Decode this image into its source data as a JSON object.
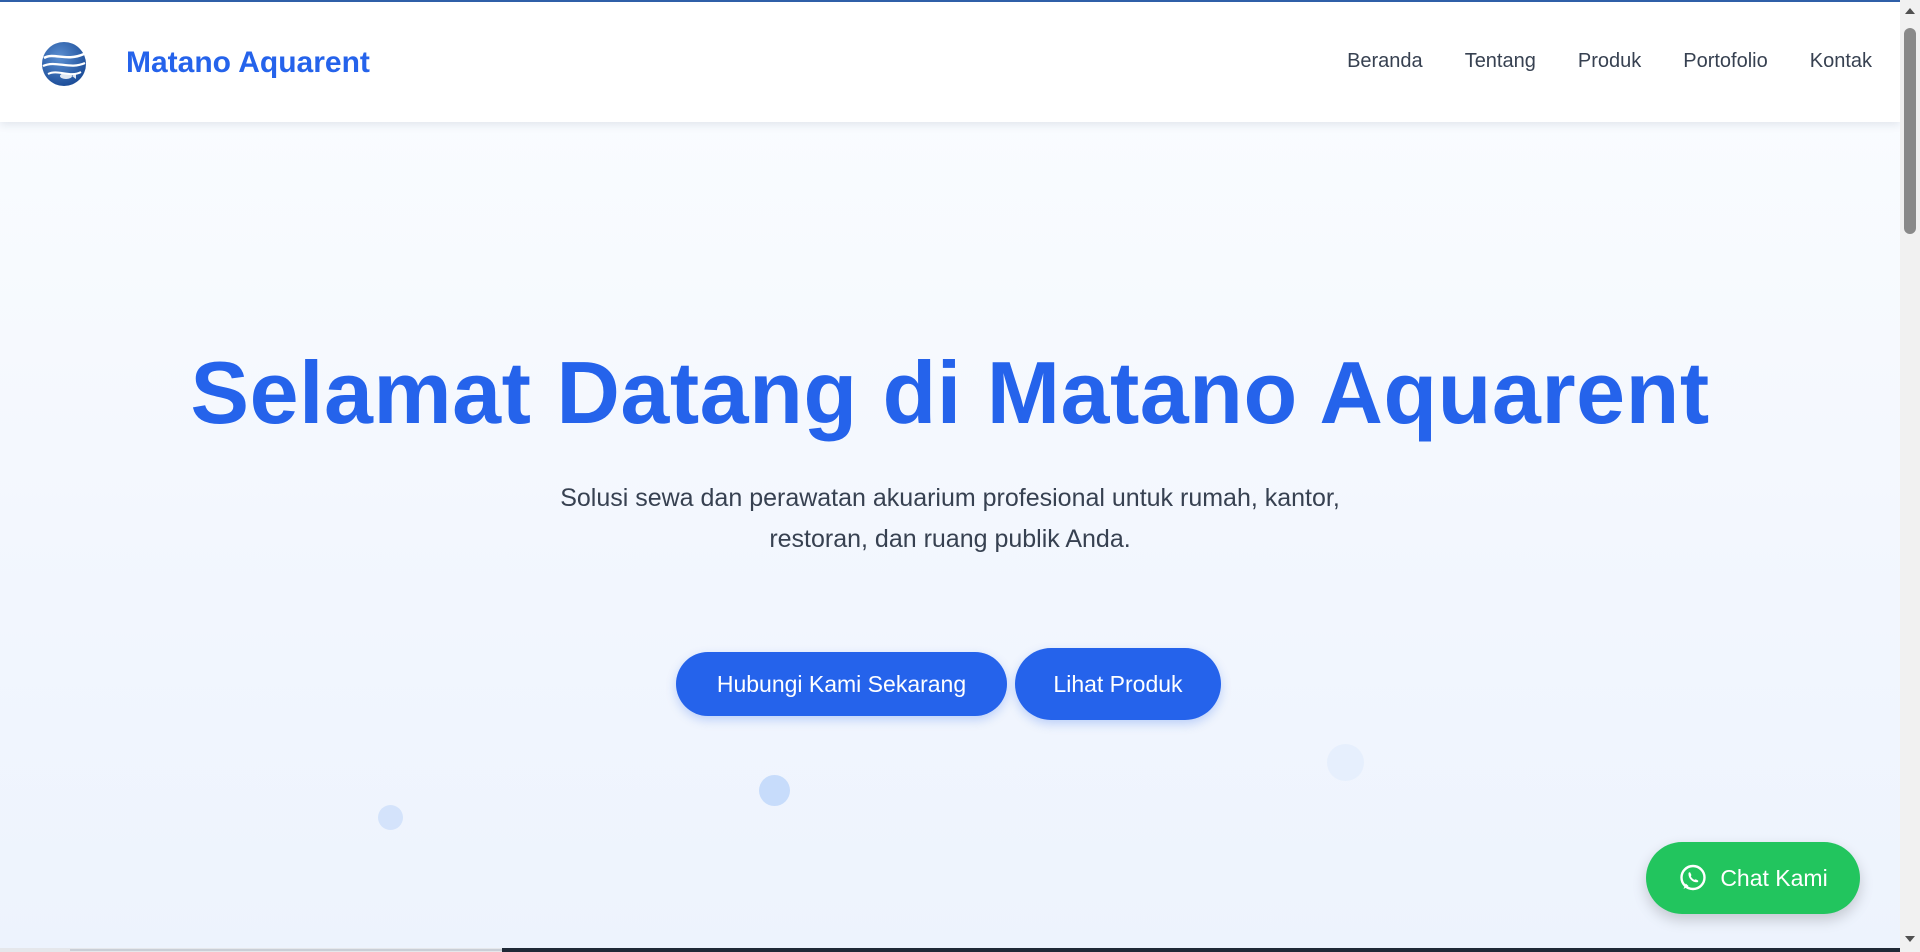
{
  "navbar": {
    "brand": "Matano Aquarent",
    "logo_icon": "globe-fish-logo",
    "links": [
      "Beranda",
      "Tentang",
      "Produk",
      "Portofolio",
      "Kontak"
    ]
  },
  "hero": {
    "title": "Selamat Datang di Matano Aquarent",
    "subtitle": "Solusi sewa dan perawatan akuarium profesional untuk rumah, kantor, restoran, dan ruang publik Anda.",
    "primary_button": "Hubungi Kami Sekarang",
    "secondary_button": "Lihat Produk"
  },
  "chat_widget": {
    "label": "Chat Kami",
    "icon": "whatsapp-icon"
  },
  "colors": {
    "brand_blue": "#2563eb",
    "chat_green": "#22c55e",
    "text_dark": "#374151"
  }
}
